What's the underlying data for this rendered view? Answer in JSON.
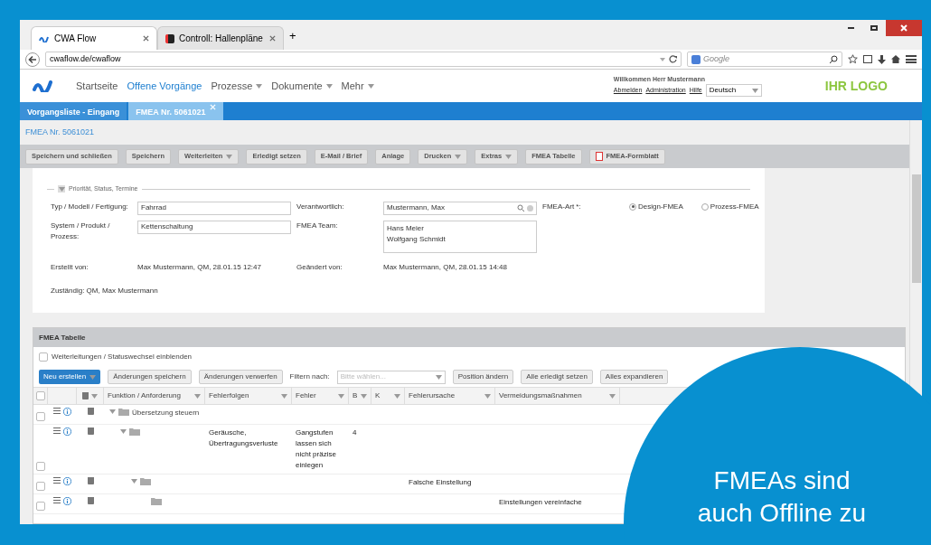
{
  "browser": {
    "tabs": [
      {
        "label": "CWA Flow",
        "selected": true
      },
      {
        "label": "Controll: Hallenpläne",
        "selected": false
      }
    ],
    "new_tab": "+",
    "url": "cwaflow.de/cwaflow",
    "search_placeholder": "Google"
  },
  "app": {
    "nav": [
      {
        "label": "Startseite",
        "selected": false,
        "dropdown": false
      },
      {
        "label": "Offene Vorgänge",
        "selected": true,
        "dropdown": false
      },
      {
        "label": "Prozesse",
        "selected": false,
        "dropdown": true
      },
      {
        "label": "Dokumente",
        "selected": false,
        "dropdown": true
      },
      {
        "label": "Mehr",
        "selected": false,
        "dropdown": true
      }
    ],
    "welcome": "Willkommen Herr Mustermann",
    "links": [
      "Abmelden",
      "Administration",
      "Hilfe"
    ],
    "language": "Deutsch",
    "logo": "IHR LOGO"
  },
  "doc_tabs": [
    {
      "label": "Vorgangsliste - Eingang",
      "selected": false,
      "closable": false
    },
    {
      "label": "FMEA Nr. 5061021",
      "selected": true,
      "closable": true
    }
  ],
  "title": "FMEA Nr. 5061021",
  "toolbar": [
    {
      "label": "Speichern und schließen",
      "kind": "button"
    },
    {
      "label": "Speichern",
      "kind": "button"
    },
    {
      "label": "Weiterleiten",
      "kind": "menu"
    },
    {
      "label": "Erledigt setzen",
      "kind": "button"
    },
    {
      "label": "E-Mail / Brief",
      "kind": "button"
    },
    {
      "label": "Anlage",
      "kind": "button"
    },
    {
      "label": "Drucken",
      "kind": "menu"
    },
    {
      "label": "Extras",
      "kind": "menu"
    },
    {
      "label": "FMEA Tabelle",
      "kind": "button"
    },
    {
      "label": "FMEA-Formblatt",
      "kind": "pdf"
    }
  ],
  "form": {
    "section": "Priorität, Status, Termine",
    "type_label": "Typ / Modell / Fertigung:",
    "type_value": "Fahrrad",
    "owner_label": "Verantwortlich:",
    "owner_value": "Mustermann, Max",
    "art_label": "FMEA-Art *:",
    "art_options": [
      {
        "label": "Design-FMEA",
        "selected": true
      },
      {
        "label": "Prozess-FMEA",
        "selected": false
      }
    ],
    "system_label": "System / Produkt / Prozess:",
    "system_value": "Kettenschaltung",
    "team_label": "FMEA Team:",
    "team_value": "Hans Meier\nWolfgang Schmidt",
    "created_label": "Erstellt von:",
    "created_value": "Max Mustermann, QM, 28.01.15 12:47",
    "changed_label": "Geändert von:",
    "changed_value": "Max Mustermann, QM, 28.01.15 14:48",
    "responsible": "Zuständig: QM, Max Mustermann"
  },
  "table_panel": {
    "title": "FMEA Tabelle",
    "show_forwarding": {
      "label": "Weiterleitungen / Statuswechsel einblenden",
      "checked": false
    },
    "new_button": "Neu erstellen",
    "buttons": [
      "Änderungen speichern",
      "Änderungen verwerfen"
    ],
    "filter_label": "Filtern nach:",
    "filter_placeholder": "Bitte wählen...",
    "buttons_right": [
      "Position ändern",
      "Alle erledigt setzen",
      "Alles expandieren"
    ],
    "select_all_checked": false,
    "columns": [
      "Funktion / Anforderung",
      "Fehlerfolgen",
      "Fehler",
      "B",
      "K",
      "Fehlerursache",
      "Vermeidungsmaßnahmen"
    ],
    "rows": [
      {
        "label": "Übersetzung steuern",
        "checked": false,
        "expanded": true,
        "cells": [
          "",
          "",
          "",
          "",
          "",
          ""
        ],
        "children": [
          {
            "checked": false,
            "expanded": true,
            "cells": [
              "Geräusche, Übertragungsverluste",
              "Gangstufen lassen sich nicht präzise einlegen",
              "4",
              "",
              "",
              ""
            ],
            "children": [
              {
                "checked": false,
                "expanded": true,
                "cells": [
                  "",
                  "",
                  "",
                  "",
                  "Falsche Einstellung",
                  ""
                ],
                "children": [
                  {
                    "checked": false,
                    "expanded": false,
                    "cells": [
                      "",
                      "",
                      "",
                      "",
                      "",
                      "Einstellungen vereinfache"
                    ]
                  }
                ]
              }
            ]
          }
        ]
      }
    ]
  },
  "overlay": {
    "lines": [
      "FMEAs sind",
      "auch Offline zu"
    ]
  }
}
